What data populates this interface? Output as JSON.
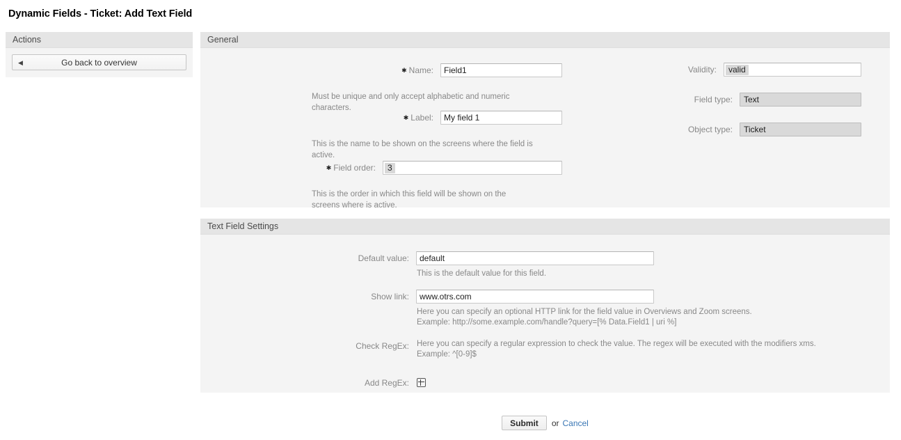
{
  "page": {
    "title": "Dynamic Fields - Ticket: Add Text Field"
  },
  "actions": {
    "header": "Actions",
    "go_back_label": "Go back to overview",
    "back_arrow_glyph": "◀"
  },
  "general": {
    "header": "General",
    "fields": {
      "name": {
        "label": "Name:",
        "required_marker": "✱",
        "value": "Field1",
        "help": "Must be unique and only accept alphabetic and numeric characters."
      },
      "label": {
        "label": "Label:",
        "required_marker": "✱",
        "value": "My field 1",
        "help": "This is the name to be shown on the screens where the field is active."
      },
      "field_order": {
        "label": "Field order:",
        "required_marker": "✱",
        "selected": "3",
        "help": "This is the order in which this field will be shown on the screens where is active."
      },
      "validity": {
        "label": "Validity:",
        "selected": "valid"
      },
      "field_type": {
        "label": "Field type:",
        "value": "Text"
      },
      "object_type": {
        "label": "Object type:",
        "value": "Ticket"
      }
    }
  },
  "settings": {
    "header": "Text Field Settings",
    "fields": {
      "default_value": {
        "label": "Default value:",
        "value": "default",
        "help": "This is the default value for this field."
      },
      "show_link": {
        "label": "Show link:",
        "value": "www.otrs.com",
        "help_line1": "Here you can specify an optional HTTP link for the field value in Overviews and Zoom screens.",
        "help_line2": "Example: http://some.example.com/handle?query=[% Data.Field1 | uri %]"
      },
      "check_regex": {
        "label": "Check RegEx:",
        "help_line1": "Here you can specify a regular expression to check the value. The regex will be executed with the modifiers xms.",
        "help_line2": "Example: ^[0-9]$"
      },
      "add_regex": {
        "label": "Add RegEx:",
        "icon": "plus-icon"
      }
    }
  },
  "footer": {
    "submit_label": "Submit",
    "or_text": "or",
    "cancel_label": "Cancel",
    "link_color": "#3a77b5"
  }
}
